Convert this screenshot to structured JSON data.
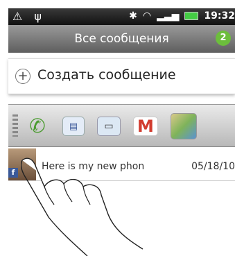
{
  "status_bar": {
    "left_icons": "⚠ ψ",
    "time": "19:32"
  },
  "header": {
    "title": "Все сообщения",
    "unread_count": "2"
  },
  "compose": {
    "plus_glyph": "+",
    "label": "Создать сообщение"
  },
  "share_bar": {
    "icons": [
      "phone-icon",
      "contact-card-icon",
      "message-icon",
      "gmail-icon",
      "map-icon"
    ],
    "gmail_glyph": "M"
  },
  "message_row": {
    "sender": "",
    "preview": "Here is my new phon",
    "date": "05/18/10",
    "source_badge": "f"
  }
}
